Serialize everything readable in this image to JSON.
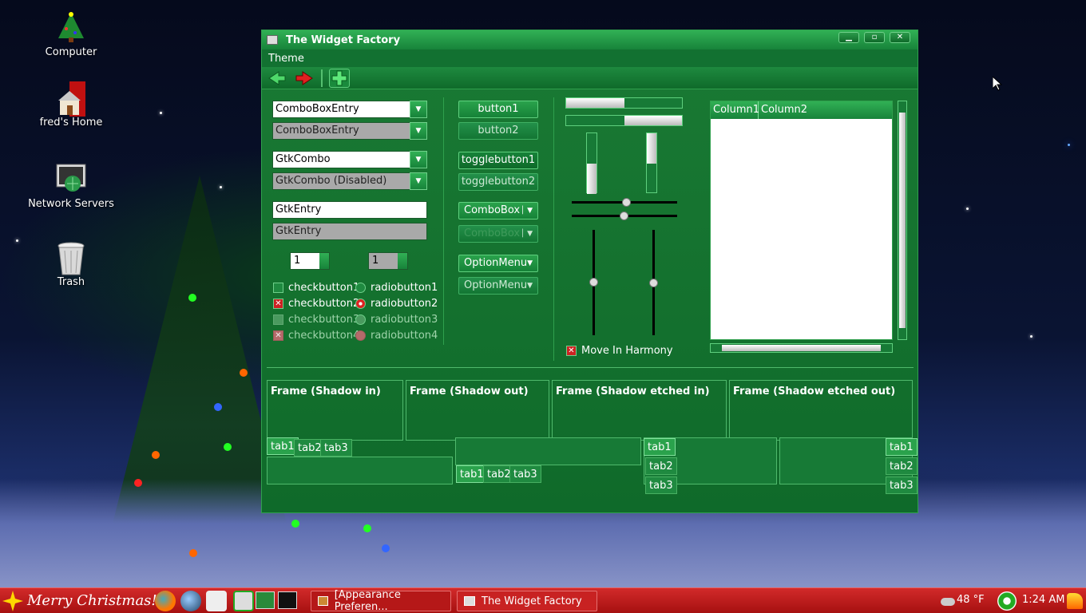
{
  "desktop": {
    "icons": [
      {
        "label": "Computer",
        "icon": "computer-tree-icon"
      },
      {
        "label": "fred's Home",
        "icon": "home-folder-icon"
      },
      {
        "label": "Network Servers",
        "icon": "network-servers-icon"
      },
      {
        "label": "Trash",
        "icon": "trash-icon"
      }
    ]
  },
  "window": {
    "title": "The Widget Factory",
    "controls": {
      "minimize": "▁",
      "maximize": "▫",
      "close": "✕"
    },
    "menu": {
      "theme": "Theme"
    },
    "combos": {
      "combobox_entry_1": "ComboBoxEntry",
      "combobox_entry_2": "ComboBoxEntry",
      "gtkcombo": "GtkCombo",
      "gtkcombo_disabled": "GtkCombo (Disabled)"
    },
    "entries": {
      "entry1": "GtkEntry",
      "entry2": "GtkEntry"
    },
    "spins": {
      "spin1": "1",
      "spin2": "1"
    },
    "checks": [
      {
        "label": "checkbutton1",
        "state": "unchecked"
      },
      {
        "label": "checkbutton2",
        "state": "checked"
      },
      {
        "label": "checkbutton3",
        "state": "disabled"
      },
      {
        "label": "checkbutton4",
        "state": "disabled-checked"
      }
    ],
    "radios": [
      {
        "label": "radiobutton1",
        "state": "unselected"
      },
      {
        "label": "radiobutton2",
        "state": "selected"
      },
      {
        "label": "radiobutton3",
        "state": "disabled"
      },
      {
        "label": "radiobutton4",
        "state": "disabled-selected"
      }
    ],
    "buttons": {
      "button1": "button1",
      "button2": "button2",
      "toggle1": "togglebutton1",
      "toggle2": "togglebutton2",
      "combobox1": "ComboBox",
      "combobox2": "ComboBox",
      "optionmenu1": "OptionMenu",
      "optionmenu2": "OptionMenu"
    },
    "progress": {
      "h1": 0.5,
      "h2": 0.5,
      "v1": 0.5,
      "v2": 0.5
    },
    "move_in_harmony": "Move In Harmony",
    "tree": {
      "columns": [
        "Column1",
        "Column2"
      ]
    },
    "frames": [
      "Frame (Shadow in)",
      "Frame (Shadow out)",
      "Frame (Shadow etched in)",
      "Frame (Shadow etched out)"
    ],
    "tabs": {
      "t1": "tab1",
      "t2": "tab2",
      "t3": "tab3"
    }
  },
  "taskbar": {
    "greeting": "Merry Christmas!",
    "tasks": [
      {
        "label": "[Appearance Preferen...",
        "active": false
      },
      {
        "label": "The Widget Factory",
        "active": true
      }
    ],
    "weather": "48 °F",
    "clock": "1:24 AM"
  },
  "colors": {
    "window_green": "#1a7a34",
    "accent_green": "#31b055",
    "taskbar_red": "#c82222"
  }
}
